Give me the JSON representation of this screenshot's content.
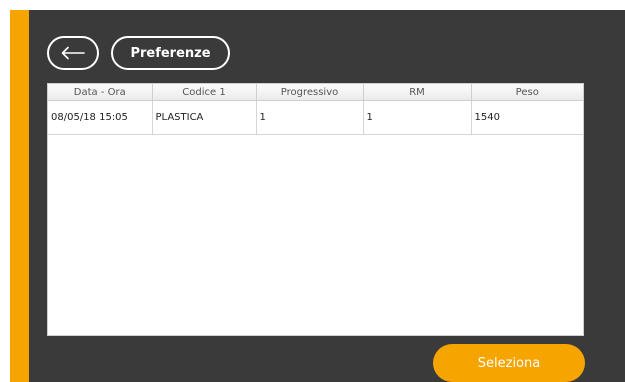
{
  "colors": {
    "accent": "#f6a400",
    "background": "#3a3a3a",
    "panel": "#ffffff"
  },
  "toolbar": {
    "back_icon": "arrow-left-icon",
    "preferences_label": "Preferenze"
  },
  "table": {
    "columns": [
      "Data - Ora",
      "Codice 1",
      "Progressivo",
      "RM",
      "Peso"
    ],
    "rows": [
      [
        "08/05/18 15:05",
        "PLASTICA",
        "1",
        "1",
        "1540"
      ]
    ]
  },
  "footer": {
    "select_label": "Seleziona"
  }
}
